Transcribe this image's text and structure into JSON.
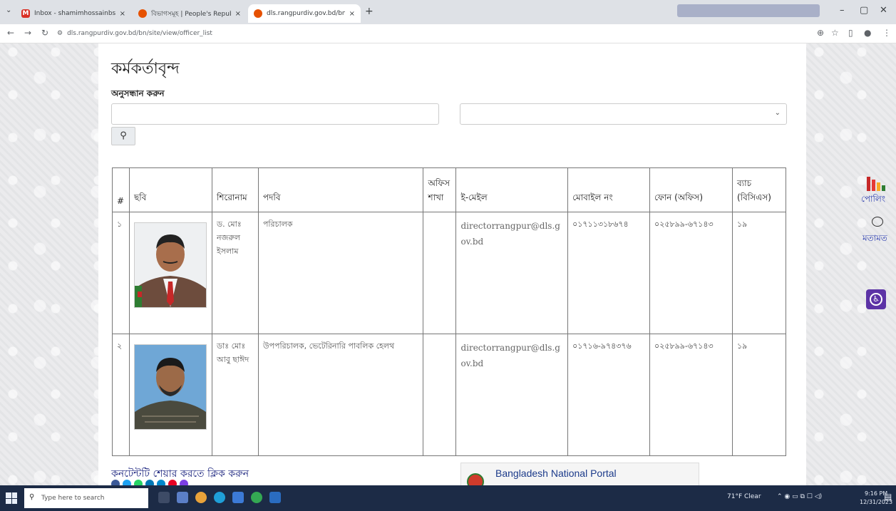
{
  "browser": {
    "tabs": [
      {
        "title": "Inbox - shamimhossainbsd@g",
        "icon": "gmail-icon",
        "active": false
      },
      {
        "title": "বিভাগসমূহ | People's Republic",
        "icon": "bd-portal-icon",
        "active": false
      },
      {
        "title": "dls.rangpurdiv.gov.bd/bn/site",
        "icon": "bd-portal-icon",
        "active": true
      }
    ],
    "url": "dls.rangpurdiv.gov.bd/bn/site/view/officer_list",
    "new_tab": "+"
  },
  "page": {
    "title": "কর্মকর্তাবৃন্দ",
    "search_label": "অনুসন্ধান করুন",
    "search_value": "",
    "select_value": "",
    "search_button_icon": "search-icon"
  },
  "table": {
    "headers": [
      "#",
      "ছবি",
      "শিরোনাম",
      "পদবি",
      "অফিস শাখা",
      "ই-মেইল",
      "মোবাইল নং",
      "ফোন (অফিস)",
      "ব্যাচ (বিসিএস)"
    ],
    "rows": [
      {
        "num": "১",
        "name": "ড. মোঃ নজরুল ইসলাম",
        "designation": "পরিচালক",
        "office": "",
        "email": "directorrangpur@dls.gov.bd",
        "mobile": "০১৭১১৩১৮৬৭৪",
        "phone": "০২৫৮৯৯-৬৭১৪৩",
        "batch": "১৯"
      },
      {
        "num": "২",
        "name": "ডাঃ মোঃ আবু ছাঈদ",
        "designation": "উপপরিচালক, ভেটেরিনারি পাবলিক হেলথ",
        "office": "",
        "email": "directorrangpur@dls.gov.bd",
        "mobile": "০১৭১৬-৯৭৪৩৭৬",
        "phone": "০২৫৮৯৯-৬৭১৪৩",
        "batch": "১৯"
      }
    ]
  },
  "footer": {
    "share_label": "কনটেন্টটি শেয়ার করতে ক্লিক করুন",
    "portal_text": "Bangladesh National Portal"
  },
  "widget": {
    "polling": "পোলিং",
    "feedback": "মতামত"
  },
  "taskbar": {
    "search_placeholder": "Type here to search",
    "weather": "71°F  Clear",
    "time": "9:16 PM",
    "date": "12/31/2023"
  },
  "colors": {
    "accent_blue": "#2a3cb0",
    "a11y_purple": "#5c33a6",
    "taskbar": "#1c2b46"
  }
}
